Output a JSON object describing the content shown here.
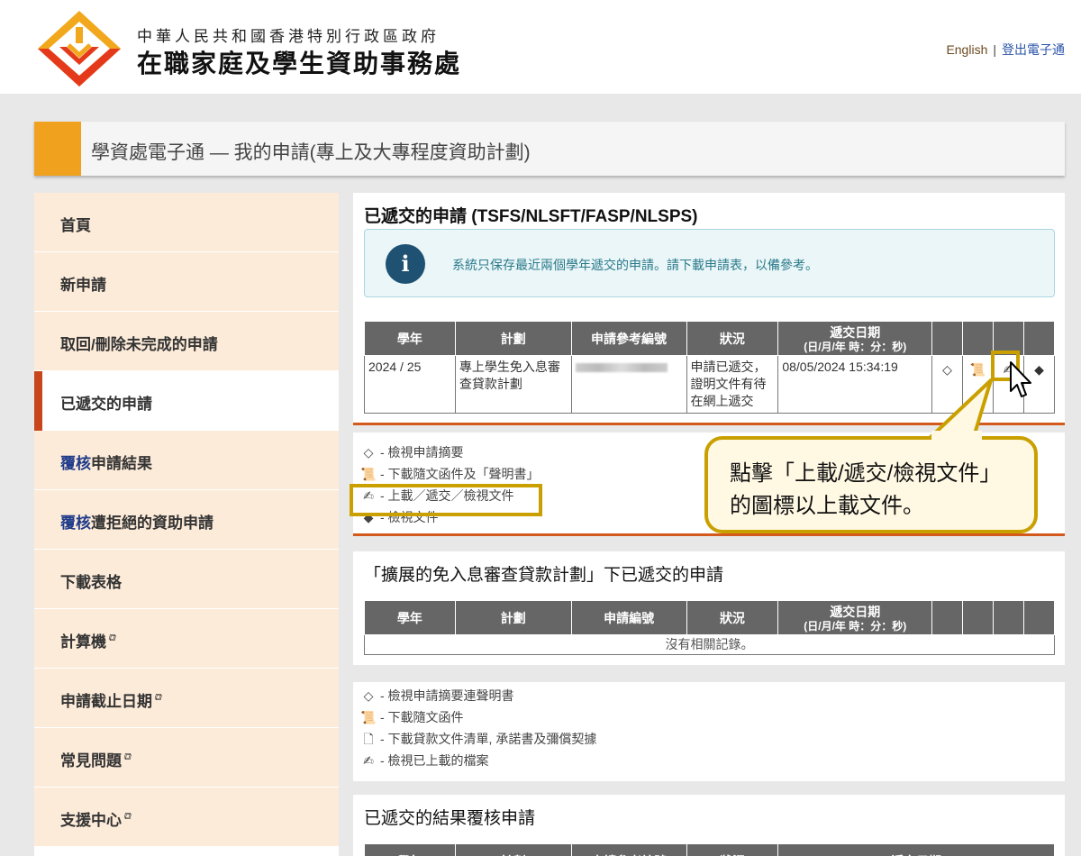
{
  "header": {
    "org_line1": "中華人民共和國香港特別行政區政府",
    "org_line2": "在職家庭及學生資助事務處",
    "english_link": "English",
    "separator": "|",
    "logout_link": "登出電子通"
  },
  "title_bar": {
    "title": "學資處電子通 — 我的申請(專上及大專程度資助計劃)"
  },
  "sidebar": {
    "items": [
      {
        "label": "首頁"
      },
      {
        "label": "新申請"
      },
      {
        "label": "取回/刪除未完成的申請"
      },
      {
        "label": "已遞交的申請"
      },
      {
        "label_blue": "覆核",
        "label": "申請結果"
      },
      {
        "label_blue": "覆核",
        "label": "遭拒絕的資助申請"
      },
      {
        "label": "下載表格"
      },
      {
        "label": "計算機"
      },
      {
        "label": "申請截止日期"
      },
      {
        "label": "常見問題"
      },
      {
        "label": "支援中心"
      }
    ],
    "external_icon": "external-link-icon"
  },
  "section1": {
    "title": "已遞交的申請 (TSFS/NLSFT/FASP/NLSPS)",
    "info_icon": "info-icon",
    "info_message": "系統只保存最近兩個學年遞交的申請。請下載申請表，以備參考。",
    "columns": [
      "學年",
      "計劃",
      "申請參考編號",
      "狀況",
      "遞交日期",
      "(日/月/年 時：分：秒)"
    ],
    "row": {
      "year": "2024 / 25",
      "scheme": "專上學生免入息審查貸款計劃",
      "status": "申請已遞交，證明文件有待在網上遞交",
      "date": "08/05/2024 15:34:19"
    },
    "legend": [
      {
        "icon": "view-summary-icon",
        "label": "- 檢視申請摘要"
      },
      {
        "icon": "download-docs-icon",
        "label": "- 下載隨文函件及「聲明書」"
      },
      {
        "icon": "upload-icon",
        "label": "- 上載／遞交／檢視文件"
      },
      {
        "icon": "view-docs-icon",
        "label": "- 檢視文件"
      }
    ]
  },
  "callout": {
    "line1": "點擊「上載/遞交/檢視文件」",
    "line2": "的圖標以上載文件。"
  },
  "section2": {
    "title": "「擴展的免入息審查貸款計劃」下已遞交的申請",
    "columns": [
      "學年",
      "計劃",
      "申請編號",
      "狀況",
      "遞交日期",
      "(日/月/年 時：分：秒)"
    ],
    "empty_message": "沒有相關記錄。",
    "legend": [
      {
        "icon": "view-summary-icon",
        "label": "- 檢視申請摘要連聲明書"
      },
      {
        "icon": "download-docs-icon",
        "label": "- 下載隨文函件"
      },
      {
        "icon": "document-icon",
        "label": "- 下載貸款文件清單, 承諾書及彌償契據"
      },
      {
        "icon": "upload-icon",
        "label": "- 檢視已上載的檔案"
      }
    ]
  },
  "section3": {
    "title": "已遞交的結果覆核申請",
    "columns": [
      "學年",
      "計劃",
      "申請參考編號",
      "狀況",
      "遞交日期"
    ]
  }
}
